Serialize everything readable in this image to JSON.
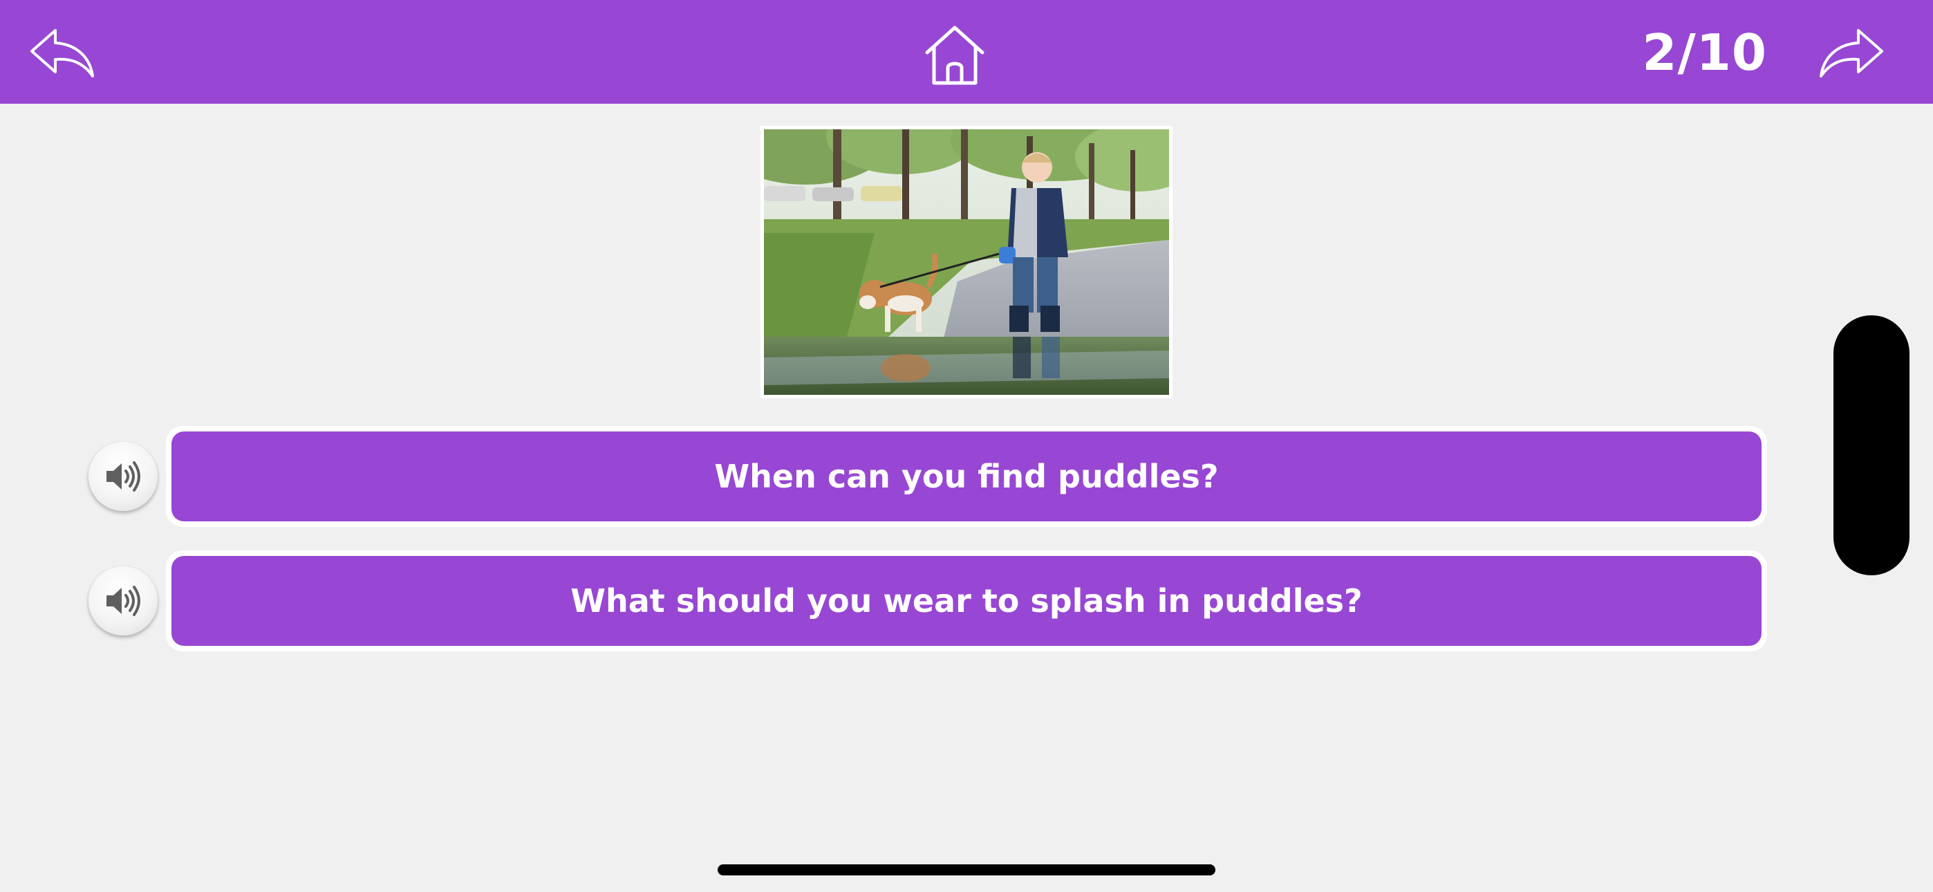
{
  "header": {
    "page_counter": "2/10",
    "back_icon": "back-arrow-icon",
    "home_icon": "home-icon",
    "forward_icon": "forward-arrow-icon"
  },
  "photo": {
    "description_icon": "photo"
  },
  "questions": [
    {
      "text": "When can you find puddles?",
      "audio_icon": "speaker-icon"
    },
    {
      "text": "What should you wear to splash in puddles?",
      "audio_icon": "speaker-icon"
    }
  ],
  "colors": {
    "accent": "#9747d3",
    "background": "#f0f0f0",
    "text_on_accent": "#ffffff"
  }
}
